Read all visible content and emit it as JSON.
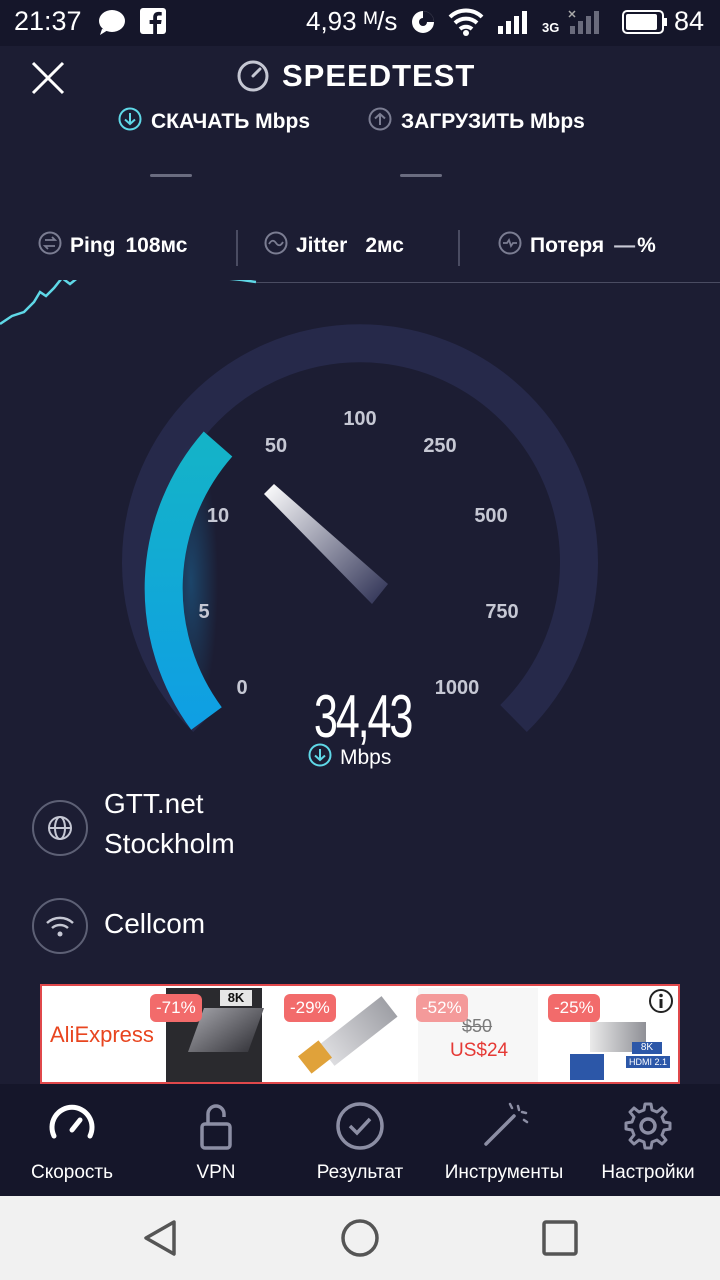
{
  "status_bar": {
    "time": "21:37",
    "net_speed": "4,93 ᴹ/s",
    "network_type": "3G",
    "battery": "84",
    "icons": [
      "chat-icon",
      "facebook-icon",
      "data-saver-icon",
      "wifi-icon",
      "signal-icon",
      "signal-off-icon",
      "battery-icon"
    ]
  },
  "header": {
    "title": "SPEEDTEST",
    "icon": "speedometer-icon",
    "close_icon": "close-icon"
  },
  "download": {
    "label": "СКАЧАТЬ Mbps",
    "icon": "download-arrow-icon",
    "value": "—"
  },
  "upload": {
    "label": "ЗАГРУЗИТЬ Mbps",
    "icon": "upload-arrow-icon",
    "value": "—"
  },
  "metrics": {
    "ping": {
      "label": "Ping",
      "value": "108мс",
      "icon": "ping-icon"
    },
    "jitter": {
      "label": "Jitter",
      "value": "2мс",
      "icon": "jitter-icon"
    },
    "loss": {
      "label": "Потеря",
      "value": "—",
      "unit": "%",
      "icon": "loss-icon"
    }
  },
  "gauge": {
    "ticks": [
      "0",
      "5",
      "10",
      "50",
      "100",
      "250",
      "500",
      "750",
      "1000"
    ],
    "current_value": "34,43",
    "unit": "Mbps",
    "fill_fraction": 0.3,
    "colors": {
      "active": "#14a3db",
      "track": "#26294a"
    }
  },
  "server": {
    "provider": "GTT.net",
    "city": "Stockholm",
    "icon": "globe-icon"
  },
  "isp": {
    "name": "Cellcom",
    "icon": "wifi-icon"
  },
  "ad": {
    "brand": "AliExpress",
    "items": [
      {
        "discount": "-71%",
        "label": "8K"
      },
      {
        "discount": "-29%"
      },
      {
        "discount": "-52%",
        "old_price": "$50",
        "price": "US$24"
      },
      {
        "discount": "-25%",
        "label": "8K",
        "sub_label": "HDMI 2.1"
      }
    ],
    "info_icon": "info-icon"
  },
  "tabs": [
    {
      "label": "Скорость",
      "icon": "speedometer-icon",
      "active": true
    },
    {
      "label": "VPN",
      "icon": "lock-icon"
    },
    {
      "label": "Результат",
      "icon": "check-circle-icon"
    },
    {
      "label": "Инструменты",
      "icon": "magic-wand-icon"
    },
    {
      "label": "Настройки",
      "icon": "gear-icon"
    }
  ],
  "nav": [
    "back-icon",
    "home-icon",
    "recents-icon"
  ]
}
